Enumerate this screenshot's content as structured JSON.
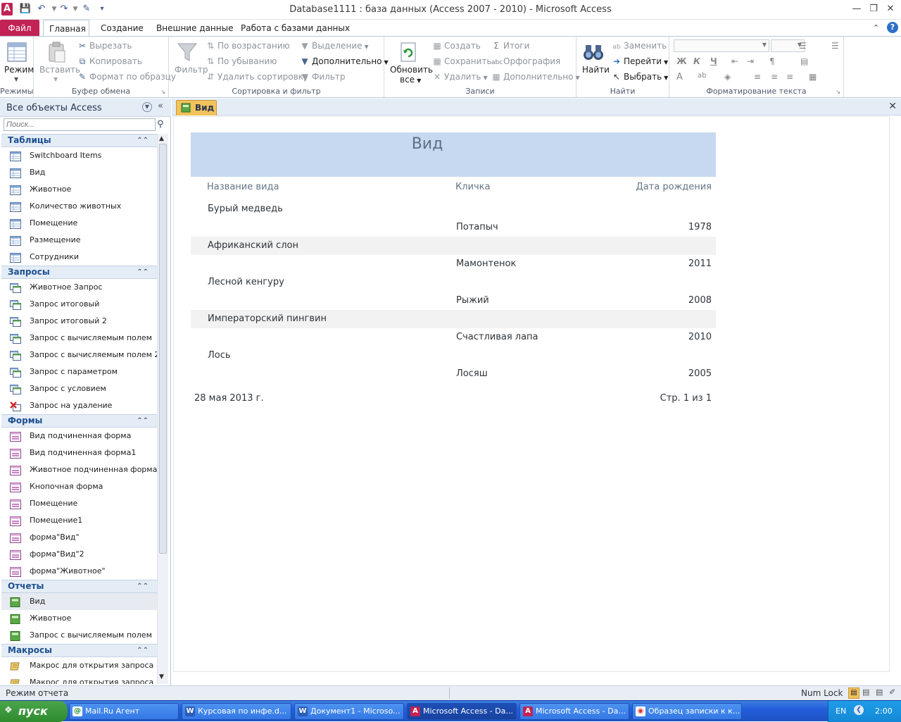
{
  "window": {
    "title": "Database1111 : база данных (Access 2007 - 2010)  -  Microsoft Access"
  },
  "ribbon_tabs": [
    "Файл",
    "Главная",
    "Создание",
    "Внешние данные",
    "Работа с базами данных"
  ],
  "ribbon": {
    "groups": {
      "views": "Режимы",
      "clipboard": "Буфер обмена",
      "sort_filter": "Сортировка и фильтр",
      "records": "Записи",
      "find": "Найти",
      "text_format": "Форматирование текста"
    },
    "mode_btn": "Режим",
    "paste_btn": "Вставить",
    "cut": "Вырезать",
    "copy": "Копировать",
    "format_painter": "Формат по образцу",
    "filter_btn": "Фильтр",
    "ascending": "По возрастанию",
    "descending": "По убыванию",
    "remove_sort": "Удалить сортировку",
    "selection": "Выделение",
    "advanced": "Дополнительно",
    "toggle_filter": "Фильтр",
    "refresh_btn_1": "Обновить",
    "refresh_btn_2": "все",
    "new_rec": "Создать",
    "save_rec": "Сохранить",
    "delete_rec": "Удалить",
    "totals": "Итоги",
    "spelling": "Орфография",
    "more": "Дополнительно",
    "find_btn": "Найти",
    "replace": "Заменить",
    "goto": "Перейти",
    "select": "Выбрать",
    "bold": "Ж",
    "italic": "К",
    "underline": "Ч"
  },
  "nav": {
    "title": "Все объекты Access",
    "search_placeholder": "Поиск...",
    "sections": [
      {
        "name": "Таблицы",
        "kind": "table",
        "items": [
          "Switchboard Items",
          "Вид",
          "Животное",
          "Количество животных",
          "Помещение",
          "Размещение",
          "Сотрудники"
        ]
      },
      {
        "name": "Запросы",
        "kind": "query",
        "items": [
          "Животное Запрос",
          "Запрос итоговый",
          "Запрос итоговый 2",
          "Запрос с вычисляемым полем",
          "Запрос с вычисляемым полем 2",
          "Запрос с параметром",
          "Запрос с условием",
          "Запрос на удаление"
        ]
      },
      {
        "name": "Формы",
        "kind": "form",
        "items": [
          "Вид подчиненная форма",
          "Вид подчиненная форма1",
          "Животное подчиненная форма",
          "Кнопочная форма",
          "Помещение",
          "Помещение1",
          "форма\"Вид\"",
          "форма\"Вид\"2",
          "форма\"Животное\""
        ]
      },
      {
        "name": "Отчеты",
        "kind": "report",
        "items": [
          "Вид",
          "Животное",
          "Запрос с вычисляемым полем"
        ]
      },
      {
        "name": "Макросы",
        "kind": "macro",
        "items": [
          "Макрос для открытия запроса ...",
          "Макрос для открытия запроса ..."
        ]
      }
    ],
    "selected": "Вид"
  },
  "doc_tab": "Вид",
  "report": {
    "title": "Вид",
    "columns": [
      "Название вида",
      "Кличка",
      "Дата рождения"
    ],
    "groups": [
      {
        "species": "Бурый медведь",
        "name": "Потапыч",
        "year": "1978"
      },
      {
        "species": "Африканский слон",
        "name": "Мамонтенок",
        "year": "2011"
      },
      {
        "species": "Лесной кенгуру",
        "name": "Рыжий",
        "year": "2008"
      },
      {
        "species": "Императорский пингвин",
        "name": "Счастливая лапа",
        "year": "2010"
      },
      {
        "species": "Лось",
        "name": "Лосяш",
        "year": "2005"
      }
    ],
    "date": "28 мая 2013 г.",
    "page": "Стр. 1 из 1"
  },
  "status": {
    "left": "Режим отчета",
    "numlock": "Num Lock"
  },
  "taskbar": {
    "start": "пуск",
    "tasks": [
      {
        "label": "Mail.Ru Агент",
        "icon": "mail-agent"
      },
      {
        "label": "Курсовая по инфе.d...",
        "icon": "word"
      },
      {
        "label": "Документ1 - Microso...",
        "icon": "word"
      },
      {
        "label": "Microsoft Access - Da...",
        "icon": "access",
        "active": true
      },
      {
        "label": "Microsoft Access - Da...",
        "icon": "access"
      },
      {
        "label": "Образец записки к к...",
        "icon": "chrome"
      }
    ],
    "lang": "EN",
    "clock": "2:00"
  }
}
